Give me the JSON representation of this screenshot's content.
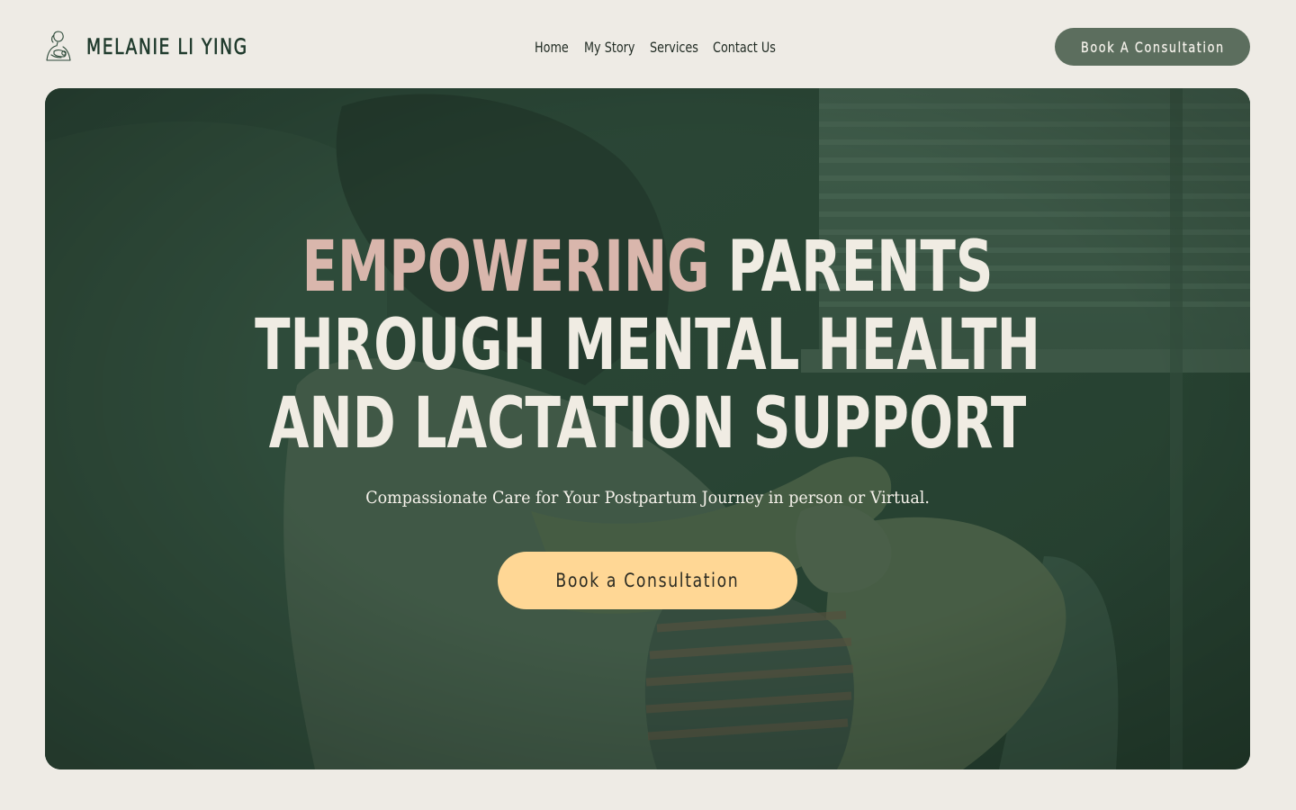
{
  "header": {
    "brand_name": "MELANIE LI YING",
    "logo_icon": "mother-holding-baby-line-icon",
    "nav": [
      {
        "label": "Home"
      },
      {
        "label": "My Story"
      },
      {
        "label": "Services"
      },
      {
        "label": "Contact Us"
      }
    ],
    "cta_label": "Book A Consultation"
  },
  "hero": {
    "title_accent": "EMPOWERING",
    "title_line1_rest": " PARENTS",
    "title_line2": "THROUGH MENTAL HEALTH",
    "title_line3": "AND LACTATION SUPPORT",
    "subtitle": "Compassionate Care for Your Postpartum Journey in person or Virtual.",
    "cta_label": "Book a Consultation",
    "background": "photo-parent-holding-child-near-window"
  },
  "colors": {
    "page_bg": "#EEEBE5",
    "brand_green": "#1F3A2C",
    "header_button": "#5C6E5E",
    "hero_accent": "#D9B6AC",
    "hero_cta": "#FFD795",
    "hero_text": "#F0ECE3"
  }
}
